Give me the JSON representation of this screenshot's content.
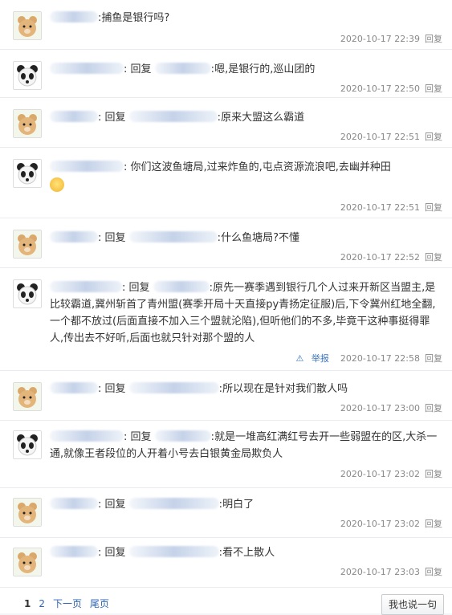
{
  "comments": [
    {
      "avatar": "bear-avatar-icon",
      "text_parts": [
        {
          "type": "text",
          "value": "捕鱼是银行吗?"
        }
      ],
      "time": "2020-10-17 22:39",
      "reply": "回复"
    },
    {
      "avatar": "panda-avatar-icon",
      "text_parts": [
        {
          "type": "text",
          "value": "回复"
        },
        {
          "type": "text",
          "value": "嗯,是银行的,巡山团的"
        }
      ],
      "time": "2020-10-17 22:50",
      "reply": "回复"
    },
    {
      "avatar": "bear-avatar-icon",
      "text_parts": [
        {
          "type": "text",
          "value": "回复"
        },
        {
          "type": "text",
          "value": "原来大盟这么霸道"
        }
      ],
      "time": "2020-10-17 22:51",
      "reply": "回复"
    },
    {
      "avatar": "panda-avatar-icon",
      "text_parts": [
        {
          "type": "text",
          "value": "你们这波鱼塘局,过来炸鱼的,屯点资源流浪吧,去幽并种田"
        }
      ],
      "time": "2020-10-17 22:51",
      "reply": "回复"
    },
    {
      "avatar": "bear-avatar-icon",
      "text_parts": [
        {
          "type": "text",
          "value": "回复"
        },
        {
          "type": "text",
          "value": "什么鱼塘局?不懂"
        }
      ],
      "time": "2020-10-17 22:52",
      "reply": "回复"
    },
    {
      "avatar": "panda-avatar-icon",
      "text_parts": [
        {
          "type": "text",
          "value": "回复"
        },
        {
          "type": "text",
          "value": "原先一赛季遇到银行几个人过来开新区当盟主,是比较霸道,冀州斩首了青州盟(赛季开局十天直接py青扬定征服)后,下令冀州红地全翻,一个都不放过(后面直接不加入三个盟就沦陷),但听他们的不多,毕竟干这种事挺得罪人,传出去不好听,后面也就只针对那个盟的人"
        }
      ],
      "time": "2020-10-17 22:58",
      "reply": "回复",
      "report": "举报"
    },
    {
      "avatar": "bear-avatar-icon",
      "text_parts": [
        {
          "type": "text",
          "value": "回复"
        },
        {
          "type": "text",
          "value": "所以现在是针对我们散人吗"
        }
      ],
      "time": "2020-10-17 23:00",
      "reply": "回复"
    },
    {
      "avatar": "panda-avatar-icon",
      "text_parts": [
        {
          "type": "text",
          "value": "回复"
        },
        {
          "type": "text",
          "value": "就是一堆高红满红号去开一些弱盟在的区,大杀一通,就像王者段位的人开着小号去白银黄金局欺负人"
        }
      ],
      "time": "2020-10-17 23:02",
      "reply": "回复"
    },
    {
      "avatar": "bear-avatar-icon",
      "text_parts": [
        {
          "type": "text",
          "value": "回复"
        },
        {
          "type": "text",
          "value": "明白了"
        }
      ],
      "time": "2020-10-17 23:02",
      "reply": "回复"
    },
    {
      "avatar": "bear-avatar-icon",
      "text_parts": [
        {
          "type": "text",
          "value": "回复"
        },
        {
          "type": "text",
          "value": "看不上散人"
        }
      ],
      "time": "2020-10-17 23:03",
      "reply": "回复"
    }
  ],
  "pager": {
    "p1": "1",
    "p2": "2",
    "next": "下一页",
    "last": "尾页"
  },
  "post_button": "我也说一句"
}
